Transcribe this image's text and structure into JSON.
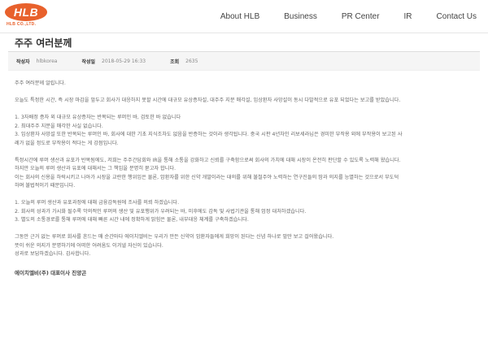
{
  "header": {
    "logo_text": "HLB",
    "logo_sub": "HLB CO.,LTD.",
    "nav": [
      "About HLB",
      "Business",
      "PR Center",
      "IR",
      "Contact Us"
    ]
  },
  "post": {
    "title": "주주 여러분께",
    "meta": {
      "author_label": "작성자",
      "author": "hlbkorea",
      "date_label": "작성일",
      "date": "2018-05-29 16:33",
      "views_label": "조회",
      "views": "2635"
    },
    "body": [
      "주주 여러분께 알립니다.",
      "",
      "오늘도 특정한 시간, 즉 시장 마감을 앞두고 회사가 대응하지 못할 시간에 대규모 유상증자설, 대주주 지분 매각설, 임상환자 사망설이 동시 다발적으로 유포 되었다는 보고를 받았습니다.",
      "",
      "1. 3자배정 증자 외 대규모 유상증자는 반복되는 루머인 바, 검토한 바 없습니다",
      "2. 최대주주 지분을 매각한 사실 없습니다.",
      "3. 임상환자 사망설 또한 반복되는 루머인 바, 회사에 대한 기초 지식조차도 없음을 반증하는 것이라 생각됩니다. 중국 시판 4년차인 리보세라닙은 경미한 부작용 외에 부작용이 보고된 사",
      "례가 없을 정도로 부작용이 적다는 게 강점입니다.",
      "",
      "특정시간에 루머 생산과 유포가 반복됨에도, 저희는 주주간담회와 IR을 통해 소통을 강화하고 신뢰를 구축함으로써 회사의 가치에 대해 시장이 온전히 판단할 수 있도록 노력해 왔습니다.",
      "하지만 오늘의 루머 생산과 유포에 대해서는 그 책임을 분명히 묻고자 합니다.",
      "이는 회사의 신용을 하락시키고 나아가 시장을 교란한 행위임은 물론, 암환자를 위한 신약 개발이라는 대의를 위해 불철주야 노력하는 연구진들의 땀과 의지를 능멸하는 것으로서 부도덕",
      "하며 불법적이기 때문입니다.",
      "",
      "1. 오늘의 루머 생산과 유포과정에 대해 금융감독원에 조사를 의뢰 하겠습니다.",
      "2. 회사의 성과가 가시화 될수록 악의적인 루머의 생산 및 유포행위가 우려되는 바, 미후에도 감독 및 사법기관을 통해 엄정 대처하겠습니다.",
      "3. 별도의 소통경로를 통해 루머에 대해 빠른 시간 내에 정확하게 밝힘은 물론, 내부대응 체계를 구축하겠습니다.",
      "",
      "그동안 근거 없는 루머로 회사를 흔드는 매 순간마다 에이치엘비는 우리가 만든 신약이 암환자들에게 희망이 된다는 신념 하나로 앞만 보고 걸어왔습니다.",
      "뜻이 쉬운 의지가 분명하기에 어떠한 어려움도 이겨낼 자신이 있습니다.",
      "성과로 보답하겠습니다. 감사합니다."
    ],
    "signature": "에이치엘비(주) 대표이사 진양곤"
  }
}
